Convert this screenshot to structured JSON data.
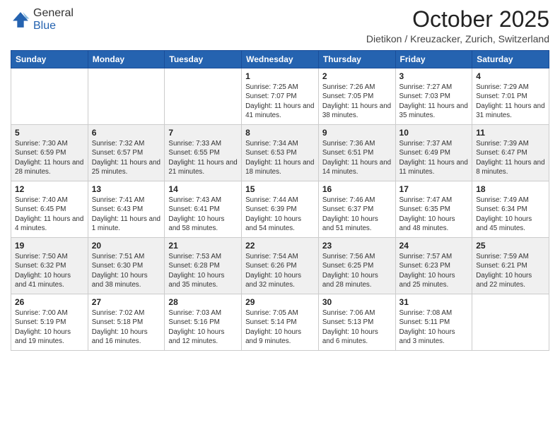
{
  "logo": {
    "general": "General",
    "blue": "Blue"
  },
  "header": {
    "month": "October 2025",
    "location": "Dietikon / Kreuzacker, Zurich, Switzerland"
  },
  "weekdays": [
    "Sunday",
    "Monday",
    "Tuesday",
    "Wednesday",
    "Thursday",
    "Friday",
    "Saturday"
  ],
  "weeks": [
    [
      {
        "day": "",
        "info": ""
      },
      {
        "day": "",
        "info": ""
      },
      {
        "day": "",
        "info": ""
      },
      {
        "day": "1",
        "info": "Sunrise: 7:25 AM\nSunset: 7:07 PM\nDaylight: 11 hours and 41 minutes."
      },
      {
        "day": "2",
        "info": "Sunrise: 7:26 AM\nSunset: 7:05 PM\nDaylight: 11 hours and 38 minutes."
      },
      {
        "day": "3",
        "info": "Sunrise: 7:27 AM\nSunset: 7:03 PM\nDaylight: 11 hours and 35 minutes."
      },
      {
        "day": "4",
        "info": "Sunrise: 7:29 AM\nSunset: 7:01 PM\nDaylight: 11 hours and 31 minutes."
      }
    ],
    [
      {
        "day": "5",
        "info": "Sunrise: 7:30 AM\nSunset: 6:59 PM\nDaylight: 11 hours and 28 minutes."
      },
      {
        "day": "6",
        "info": "Sunrise: 7:32 AM\nSunset: 6:57 PM\nDaylight: 11 hours and 25 minutes."
      },
      {
        "day": "7",
        "info": "Sunrise: 7:33 AM\nSunset: 6:55 PM\nDaylight: 11 hours and 21 minutes."
      },
      {
        "day": "8",
        "info": "Sunrise: 7:34 AM\nSunset: 6:53 PM\nDaylight: 11 hours and 18 minutes."
      },
      {
        "day": "9",
        "info": "Sunrise: 7:36 AM\nSunset: 6:51 PM\nDaylight: 11 hours and 14 minutes."
      },
      {
        "day": "10",
        "info": "Sunrise: 7:37 AM\nSunset: 6:49 PM\nDaylight: 11 hours and 11 minutes."
      },
      {
        "day": "11",
        "info": "Sunrise: 7:39 AM\nSunset: 6:47 PM\nDaylight: 11 hours and 8 minutes."
      }
    ],
    [
      {
        "day": "12",
        "info": "Sunrise: 7:40 AM\nSunset: 6:45 PM\nDaylight: 11 hours and 4 minutes."
      },
      {
        "day": "13",
        "info": "Sunrise: 7:41 AM\nSunset: 6:43 PM\nDaylight: 11 hours and 1 minute."
      },
      {
        "day": "14",
        "info": "Sunrise: 7:43 AM\nSunset: 6:41 PM\nDaylight: 10 hours and 58 minutes."
      },
      {
        "day": "15",
        "info": "Sunrise: 7:44 AM\nSunset: 6:39 PM\nDaylight: 10 hours and 54 minutes."
      },
      {
        "day": "16",
        "info": "Sunrise: 7:46 AM\nSunset: 6:37 PM\nDaylight: 10 hours and 51 minutes."
      },
      {
        "day": "17",
        "info": "Sunrise: 7:47 AM\nSunset: 6:35 PM\nDaylight: 10 hours and 48 minutes."
      },
      {
        "day": "18",
        "info": "Sunrise: 7:49 AM\nSunset: 6:34 PM\nDaylight: 10 hours and 45 minutes."
      }
    ],
    [
      {
        "day": "19",
        "info": "Sunrise: 7:50 AM\nSunset: 6:32 PM\nDaylight: 10 hours and 41 minutes."
      },
      {
        "day": "20",
        "info": "Sunrise: 7:51 AM\nSunset: 6:30 PM\nDaylight: 10 hours and 38 minutes."
      },
      {
        "day": "21",
        "info": "Sunrise: 7:53 AM\nSunset: 6:28 PM\nDaylight: 10 hours and 35 minutes."
      },
      {
        "day": "22",
        "info": "Sunrise: 7:54 AM\nSunset: 6:26 PM\nDaylight: 10 hours and 32 minutes."
      },
      {
        "day": "23",
        "info": "Sunrise: 7:56 AM\nSunset: 6:25 PM\nDaylight: 10 hours and 28 minutes."
      },
      {
        "day": "24",
        "info": "Sunrise: 7:57 AM\nSunset: 6:23 PM\nDaylight: 10 hours and 25 minutes."
      },
      {
        "day": "25",
        "info": "Sunrise: 7:59 AM\nSunset: 6:21 PM\nDaylight: 10 hours and 22 minutes."
      }
    ],
    [
      {
        "day": "26",
        "info": "Sunrise: 7:00 AM\nSunset: 5:19 PM\nDaylight: 10 hours and 19 minutes."
      },
      {
        "day": "27",
        "info": "Sunrise: 7:02 AM\nSunset: 5:18 PM\nDaylight: 10 hours and 16 minutes."
      },
      {
        "day": "28",
        "info": "Sunrise: 7:03 AM\nSunset: 5:16 PM\nDaylight: 10 hours and 12 minutes."
      },
      {
        "day": "29",
        "info": "Sunrise: 7:05 AM\nSunset: 5:14 PM\nDaylight: 10 hours and 9 minutes."
      },
      {
        "day": "30",
        "info": "Sunrise: 7:06 AM\nSunset: 5:13 PM\nDaylight: 10 hours and 6 minutes."
      },
      {
        "day": "31",
        "info": "Sunrise: 7:08 AM\nSunset: 5:11 PM\nDaylight: 10 hours and 3 minutes."
      },
      {
        "day": "",
        "info": ""
      }
    ]
  ]
}
